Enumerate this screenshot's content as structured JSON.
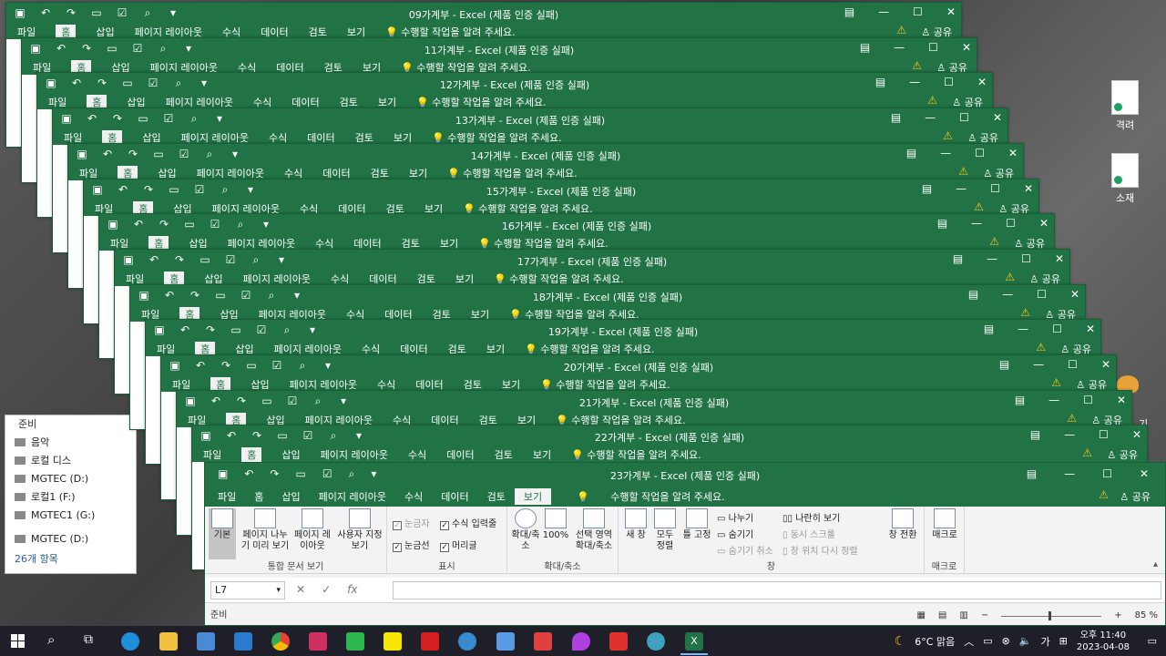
{
  "desktop": {
    "icons": [
      {
        "label": "격려"
      },
      {
        "label": "소재"
      }
    ],
    "right_text": "기"
  },
  "explorer": {
    "status_top": "준비",
    "items": [
      "음악",
      "로컬 디스",
      "MGTEC (D:)",
      "로컬1 (F:)",
      "MGTEC1 (G:)",
      "MGTEC (D:)"
    ],
    "count": "26개 항목"
  },
  "back_windows": [
    {
      "title": "09가계부 - Excel (제품 인증 실패)"
    },
    {
      "title": "11가계부 - Excel (제품 인증 실패)"
    },
    {
      "title": "12가계부 - Excel (제품 인증 실패)"
    },
    {
      "title": "13가계부 - Excel (제품 인증 실패)"
    },
    {
      "title": "14가계부 - Excel (제품 인증 실패)"
    },
    {
      "title": "15가계부 - Excel (제품 인증 실패)"
    },
    {
      "title": "16가계부 - Excel (제품 인증 실패)"
    },
    {
      "title": "17가계부 - Excel (제품 인증 실패)"
    },
    {
      "title": "18가계부 - Excel (제품 인증 실패)"
    },
    {
      "title": "19가계부 - Excel (제품 인증 실패)"
    },
    {
      "title": "20가계부 - Excel (제품 인증 실패)"
    },
    {
      "title": "21가계부 - Excel (제품 인증 실패)"
    },
    {
      "title": "22가계부 - Excel (제품 인증 실패)"
    }
  ],
  "common": {
    "tabs": [
      "파일",
      "홈",
      "삽입",
      "페이지 레이아웃",
      "수식",
      "데이터",
      "검토",
      "보기"
    ],
    "tellme": "수행할 작업을 알려 주세요.",
    "share": "공유"
  },
  "front": {
    "title": "23가계부 - Excel (제품 인증 실패)",
    "active_tab": "보기",
    "groups": {
      "workbook_views": {
        "label": "통합 문서 보기",
        "normal": "기본",
        "page_break": "페이지 나누기 미리 보기",
        "page_layout": "페이지 레이아웃",
        "custom": "사용자 지정 보기"
      },
      "show": {
        "label": "표시",
        "ruler": "눈금자",
        "formula_bar": "수식 입력줄",
        "gridlines": "눈금선",
        "headings": "머리글"
      },
      "zoom": {
        "label": "확대/축소",
        "zoom": "확대/축소",
        "hundred": "100%",
        "to_selection": "선택 영역 확대/축소"
      },
      "window": {
        "label": "창",
        "new_window": "새 창",
        "arrange_all": "모두 정렬",
        "freeze": "틀 고정",
        "split": "나누기",
        "hide": "숨기기",
        "unhide": "숨기기 취소",
        "side_by_side": "나란히 보기",
        "sync_scroll": "동시 스크롤",
        "reset_position": "창 위치 다시 정렬",
        "switch": "창 전환"
      },
      "macros": {
        "label": "매크로",
        "macros": "매크로"
      }
    },
    "name_box": "L7",
    "status": "준비",
    "zoom_level": "85 %"
  },
  "taskbar": {
    "weather": "6°C 맑음",
    "time": "오후 11:40",
    "date": "2023-04-08",
    "lang": "가"
  }
}
